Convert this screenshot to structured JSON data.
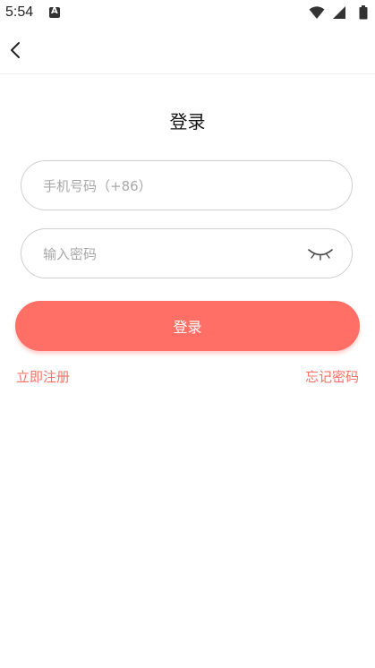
{
  "status_bar": {
    "time": "5:54",
    "icons": [
      "a-notification-icon",
      "wifi-icon",
      "signal-icon",
      "battery-icon"
    ]
  },
  "header": {
    "back_icon": "back-arrow-icon"
  },
  "login": {
    "title": "登录",
    "phone_placeholder": "手机号码（+86）",
    "password_placeholder": "输入密码",
    "password_toggle_icon": "eye-closed-icon",
    "submit_label": "登录",
    "register_link": "立即注册",
    "forgot_link": "忘记密码"
  },
  "colors": {
    "accent": "#ff6f66",
    "border": "#cfcfcf",
    "placeholder": "#a8a8a8"
  }
}
